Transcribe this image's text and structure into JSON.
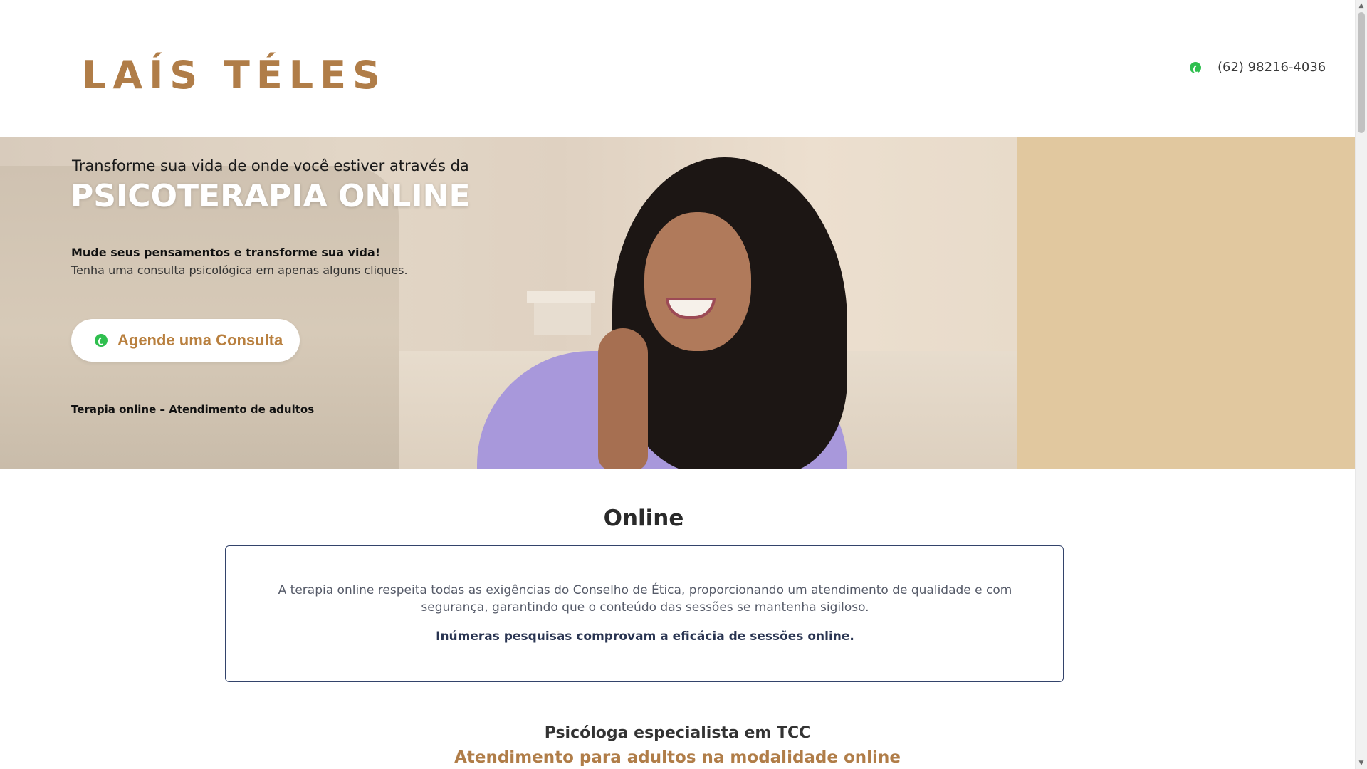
{
  "header": {
    "logo": "LAÍS TÉLES",
    "phone": "(62) 98216-4036"
  },
  "hero": {
    "subtitle": "Transforme sua vida de onde você estiver através da",
    "title": "PSICOTERAPIA ONLINE",
    "tagline": "Mude seus pensamentos e transforme sua vida!",
    "description": "Tenha uma consulta psicológica em apenas alguns cliques.",
    "cta_label": "Agende uma Consulta",
    "footnote": "Terapia online – Atendimento de adultos"
  },
  "online": {
    "heading": "Online",
    "text": "A terapia online respeita todas as exigências do Conselho de Ética, proporcionando um atendimento de qualidade e com segurança, garantindo que o conteúdo das sessões se mantenha sigiloso.",
    "emphasis": "Inúmeras pesquisas comprovam a eficácia de sessões online."
  },
  "tcc": {
    "title": "Psicóloga especialista em TCC",
    "subtitle": "Atendimento para adultos na modalidade online"
  },
  "icons": {
    "whatsapp": "whatsapp-icon"
  },
  "colors": {
    "brand": "#b07d48",
    "hero_side": "#e1c89f",
    "box_border": "#33436b",
    "whatsapp_green": "#2fbf4f"
  }
}
